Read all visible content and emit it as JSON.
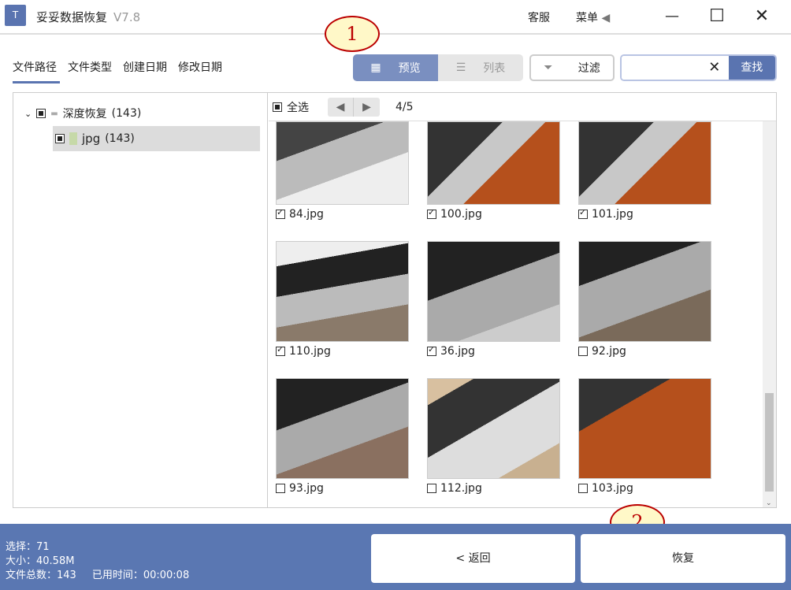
{
  "app": {
    "title": "妥妥数据恢复",
    "version": "V7.8",
    "logo_text": "T"
  },
  "titlebar": {
    "support": "客服",
    "menu": "菜单",
    "menu_arrow": "◀",
    "minimize": "—",
    "maximize": "☐",
    "close": "✕"
  },
  "tabs": [
    {
      "label": "文件路径",
      "active": true
    },
    {
      "label": "文件类型"
    },
    {
      "label": "创建日期"
    },
    {
      "label": "修改日期"
    }
  ],
  "toolbar": {
    "preview": "预览",
    "list": "列表",
    "filter": "过滤",
    "search_value": "",
    "search_button": "查找",
    "clear": "✕"
  },
  "tree": {
    "root": {
      "label": "深度恢复",
      "count": "(143)"
    },
    "child": {
      "label": "jpg",
      "count": "(143)"
    }
  },
  "grid": {
    "select_all": "全选",
    "page": "4/5",
    "prev": "◀",
    "next": "▶",
    "items": [
      {
        "name": "84.jpg",
        "checked": true
      },
      {
        "name": "100.jpg",
        "checked": true
      },
      {
        "name": "101.jpg",
        "checked": true
      },
      {
        "name": "110.jpg",
        "checked": true
      },
      {
        "name": "36.jpg",
        "checked": true
      },
      {
        "name": "92.jpg",
        "checked": false
      },
      {
        "name": "93.jpg",
        "checked": false
      },
      {
        "name": "112.jpg",
        "checked": false
      },
      {
        "name": "103.jpg",
        "checked": false
      }
    ]
  },
  "footer": {
    "selected": "选择：71",
    "size": "大小：40.58M",
    "total": "文件总数：143",
    "elapsed": "已用时间：00:00:08",
    "back": "< 返回",
    "recover": "恢复"
  },
  "callouts": [
    "1",
    "2"
  ],
  "colors": {
    "accent": "#5a74b0",
    "footer": "#5a77b2"
  }
}
